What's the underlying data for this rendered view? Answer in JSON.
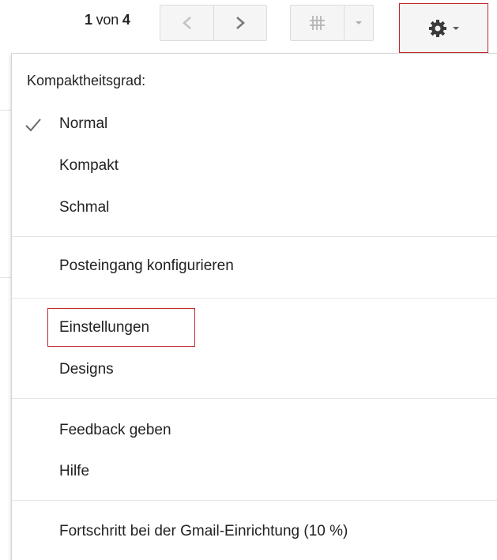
{
  "toolbar": {
    "pager_current": "1",
    "pager_of": "von",
    "pager_total": "4",
    "prev_icon": "chevron-left-icon",
    "next_icon": "chevron-right-icon",
    "input_icon": "keyboard-input-icon",
    "dropdown_icon": "caret-down-icon",
    "settings_icon": "gear-icon"
  },
  "menu": {
    "heading": "Kompaktheitsgrad:",
    "density_options": [
      {
        "label": "Normal",
        "checked": true
      },
      {
        "label": "Kompakt",
        "checked": false
      },
      {
        "label": "Schmal",
        "checked": false
      }
    ],
    "configure_inbox": "Posteingang konfigurieren",
    "settings": "Einstellungen",
    "themes": "Designs",
    "feedback": "Feedback geben",
    "help": "Hilfe",
    "gmail_setup_progress": "Fortschritt bei der Gmail-Einrichtung (10 %)"
  },
  "colors": {
    "highlight": "#c0272d",
    "button_bg": "#f5f5f5",
    "border": "#dcdcdc"
  }
}
